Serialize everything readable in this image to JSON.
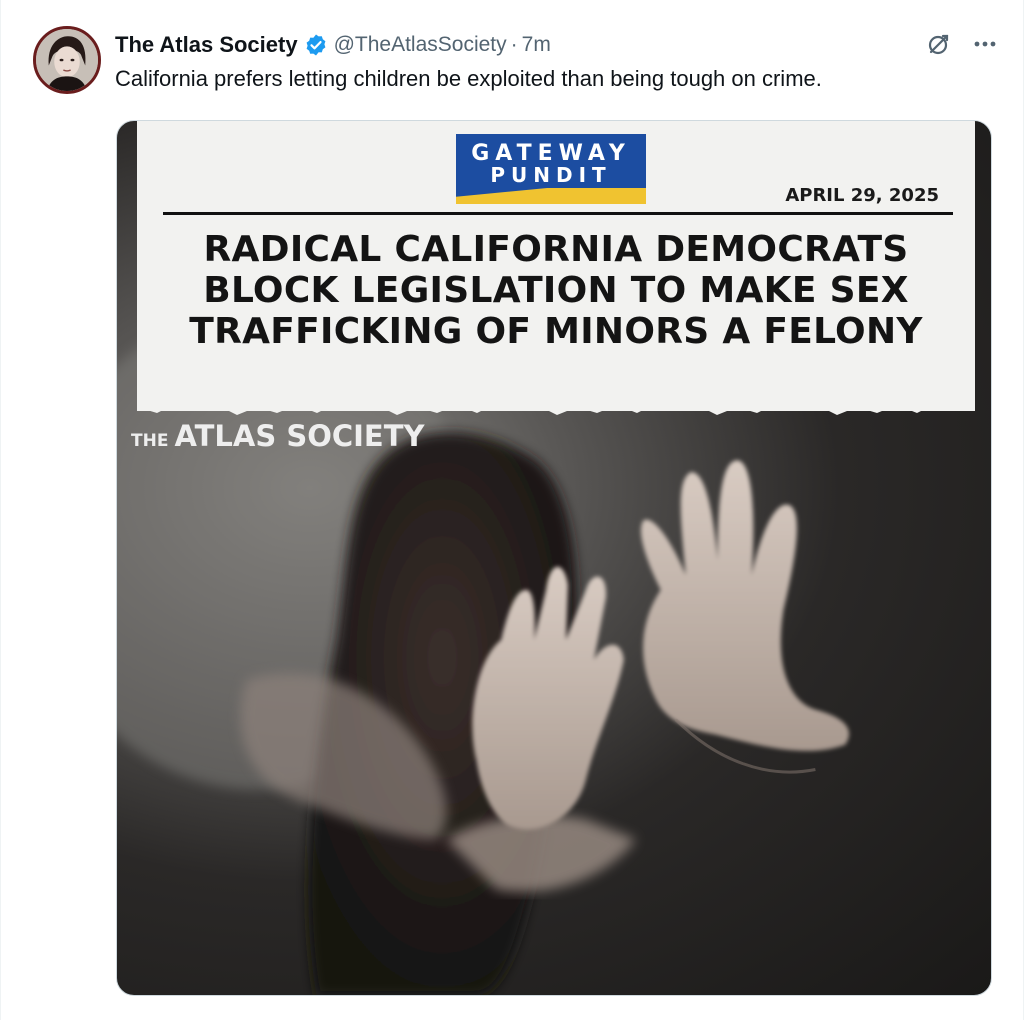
{
  "tweet": {
    "author_name": "The Atlas Society",
    "handle": "@TheAtlasSociety",
    "separator": "·",
    "time": "7m",
    "text": "California prefers letting children be exploited than being tough on crime.",
    "verified_color": "#1d9bf0"
  },
  "media": {
    "logo_line1": "GATEWAY",
    "logo_line2": "PUNDIT",
    "date": "APRIL 29, 2025",
    "headline": [
      "RADICAL CALIFORNIA DEMOCRATS",
      "BLOCK LEGISLATION TO MAKE SEX",
      "TRAFFICKING OF MINORS A FELONY"
    ],
    "watermark_prefix": "THE",
    "watermark_text": "ATLAS SOCIETY",
    "logo_blue": "#1c4da1",
    "logo_yellow": "#f0c330"
  },
  "icons": {
    "grok": "grok-icon",
    "more": "more-icon",
    "verified": "verified-badge-icon"
  }
}
